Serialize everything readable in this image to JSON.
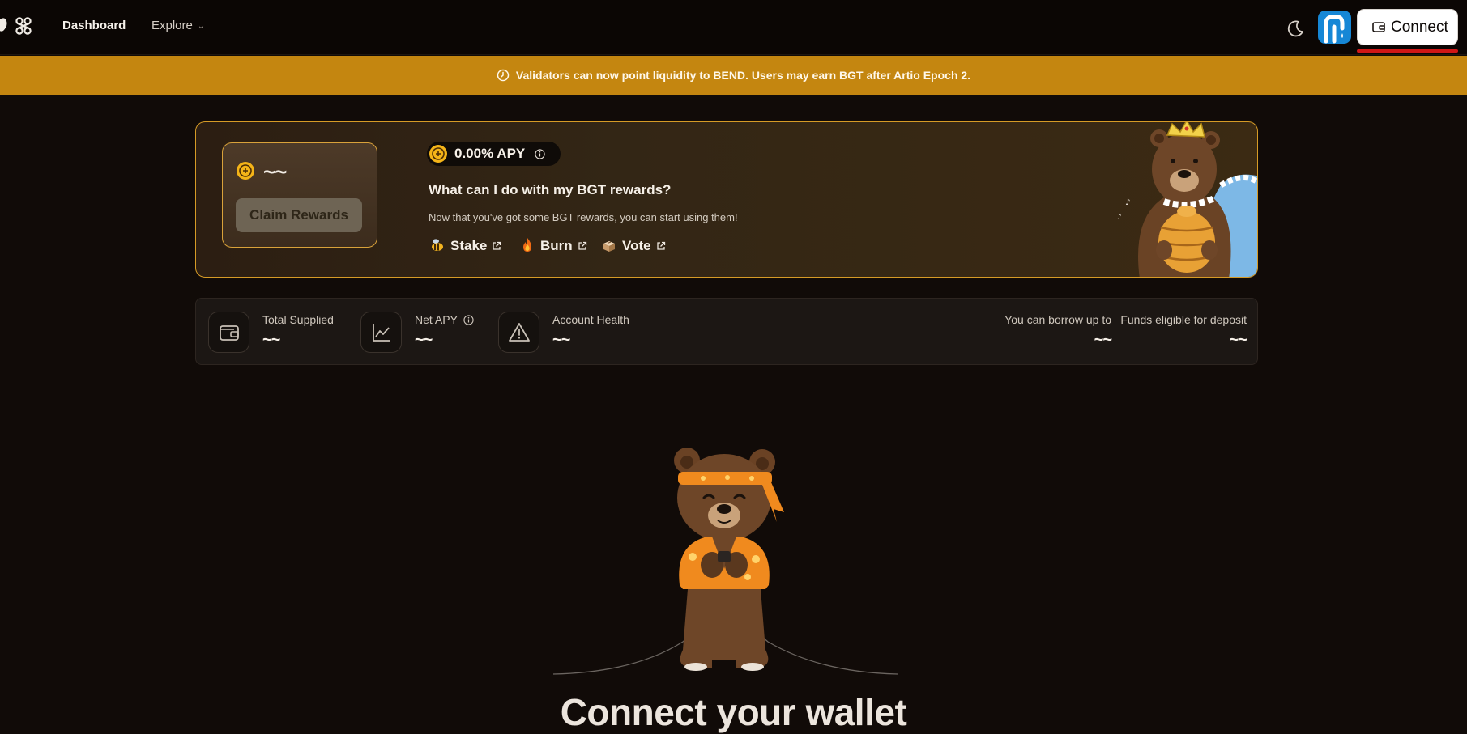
{
  "header": {
    "nav": [
      {
        "label": "Dashboard"
      },
      {
        "label": "Explore"
      }
    ],
    "connect_label": "Connect"
  },
  "banner": {
    "text": "Validators can now point liquidity to BEND. Users may earn BGT after Artio Epoch 2."
  },
  "rewards": {
    "amount": "~~",
    "claim_label": "Claim Rewards",
    "apy": "0.00% APY",
    "title": "What can I do with my BGT rewards?",
    "subtitle": "Now that you've got some BGT rewards, you can start using them!",
    "actions": [
      {
        "label": "Stake",
        "icon": "bee-icon"
      },
      {
        "label": "Burn",
        "icon": "fire-icon"
      },
      {
        "label": "Vote",
        "icon": "ballot-box-icon"
      }
    ]
  },
  "stats": {
    "total_supplied": {
      "label": "Total Supplied",
      "value": "~~"
    },
    "net_apy": {
      "label": "Net APY",
      "value": "~~"
    },
    "account_health": {
      "label": "Account Health",
      "value": "~~"
    },
    "borrow": {
      "label": "You can borrow up to",
      "value": "~~"
    },
    "eligible": {
      "label": "Funds eligible for deposit",
      "value": "~~"
    }
  },
  "hero": {
    "title": "Connect your wallet"
  },
  "colors": {
    "background": "#110b08",
    "banner": "#c48610",
    "accent_border": "#d69b26",
    "connect_underline": "#d01616",
    "faucet": "#1687d6"
  }
}
